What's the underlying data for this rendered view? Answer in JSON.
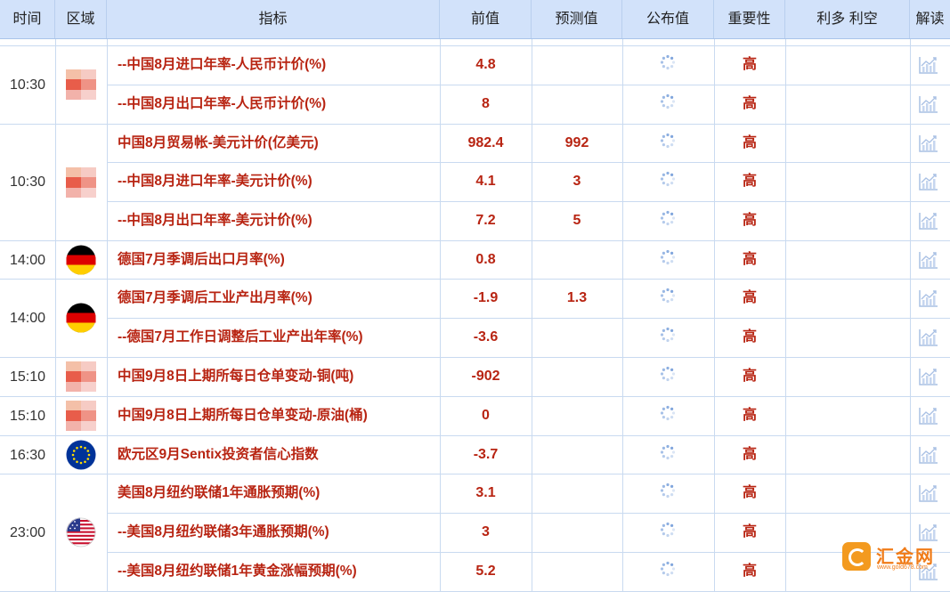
{
  "header": {
    "time": "时间",
    "region": "区域",
    "indicator": "指标",
    "previous": "前值",
    "forecast": "预测值",
    "actual": "公布值",
    "importance": "重要性",
    "impact": "利多 利空",
    "analysis": "解读"
  },
  "rows": [
    {
      "indicator": "--中国8月进口年率-人民币计价(%)",
      "previous": "4.8",
      "forecast": "",
      "importance": "高"
    },
    {
      "indicator": "--中国8月出口年率-人民币计价(%)",
      "previous": "8",
      "forecast": "",
      "importance": "高"
    },
    {
      "indicator": "中国8月贸易帐-美元计价(亿美元)",
      "previous": "982.4",
      "forecast": "992",
      "importance": "高"
    },
    {
      "indicator": "--中国8月进口年率-美元计价(%)",
      "previous": "4.1",
      "forecast": "3",
      "importance": "高"
    },
    {
      "indicator": "--中国8月出口年率-美元计价(%)",
      "previous": "7.2",
      "forecast": "5",
      "importance": "高"
    },
    {
      "indicator": "德国7月季调后出口月率(%)",
      "previous": "0.8",
      "forecast": "",
      "importance": "高"
    },
    {
      "indicator": "德国7月季调后工业产出月率(%)",
      "previous": "-1.9",
      "forecast": "1.3",
      "importance": "高"
    },
    {
      "indicator": "--德国7月工作日调整后工业产出年率(%)",
      "previous": "-3.6",
      "forecast": "",
      "importance": "高"
    },
    {
      "indicator": "中国9月8日上期所每日仓单变动-铜(吨)",
      "previous": "-902",
      "forecast": "",
      "importance": "高"
    },
    {
      "indicator": "中国9月8日上期所每日仓单变动-原油(桶)",
      "previous": "0",
      "forecast": "",
      "importance": "高"
    },
    {
      "indicator": "欧元区9月Sentix投资者信心指数",
      "previous": "-3.7",
      "forecast": "",
      "importance": "高"
    },
    {
      "indicator": "美国8月纽约联储1年通胀预期(%)",
      "previous": "3.1",
      "forecast": "",
      "importance": "高"
    },
    {
      "indicator": "--美国8月纽约联储3年通胀预期(%)",
      "previous": "3",
      "forecast": "",
      "importance": "高"
    },
    {
      "indicator": "--美国8月纽约联储1年黄金涨幅预期(%)",
      "previous": "5.2",
      "forecast": "",
      "importance": "高"
    }
  ],
  "time_groups": [
    {
      "time": "10:30",
      "region": "china",
      "region_icon": "china-flag-icon"
    },
    {
      "time": "10:30",
      "region": "china",
      "region_icon": "china-flag-icon"
    },
    {
      "time": "14:00",
      "region": "germany",
      "region_icon": "germany-flag-icon"
    },
    {
      "time": "14:00",
      "region": "germany",
      "region_icon": "germany-flag-icon"
    },
    {
      "time": "15:10",
      "region": "china",
      "region_icon": "china-flag-icon"
    },
    {
      "time": "15:10",
      "region": "china",
      "region_icon": "china-flag-icon"
    },
    {
      "time": "16:30",
      "region": "eurozone",
      "region_icon": "eu-flag-icon"
    },
    {
      "time": "23:00",
      "region": "usa",
      "region_icon": "us-flag-icon"
    }
  ],
  "icons": {
    "actual_pending": "loading-spinner-icon",
    "analysis": "chart-icon"
  },
  "watermark": {
    "name": "汇金网",
    "url": "www.gold678.com"
  },
  "colors": {
    "header_bg": "#d2e2fa",
    "value_red": "#b82412",
    "grid": "#c9daf0",
    "watermark": "#f07c19"
  }
}
